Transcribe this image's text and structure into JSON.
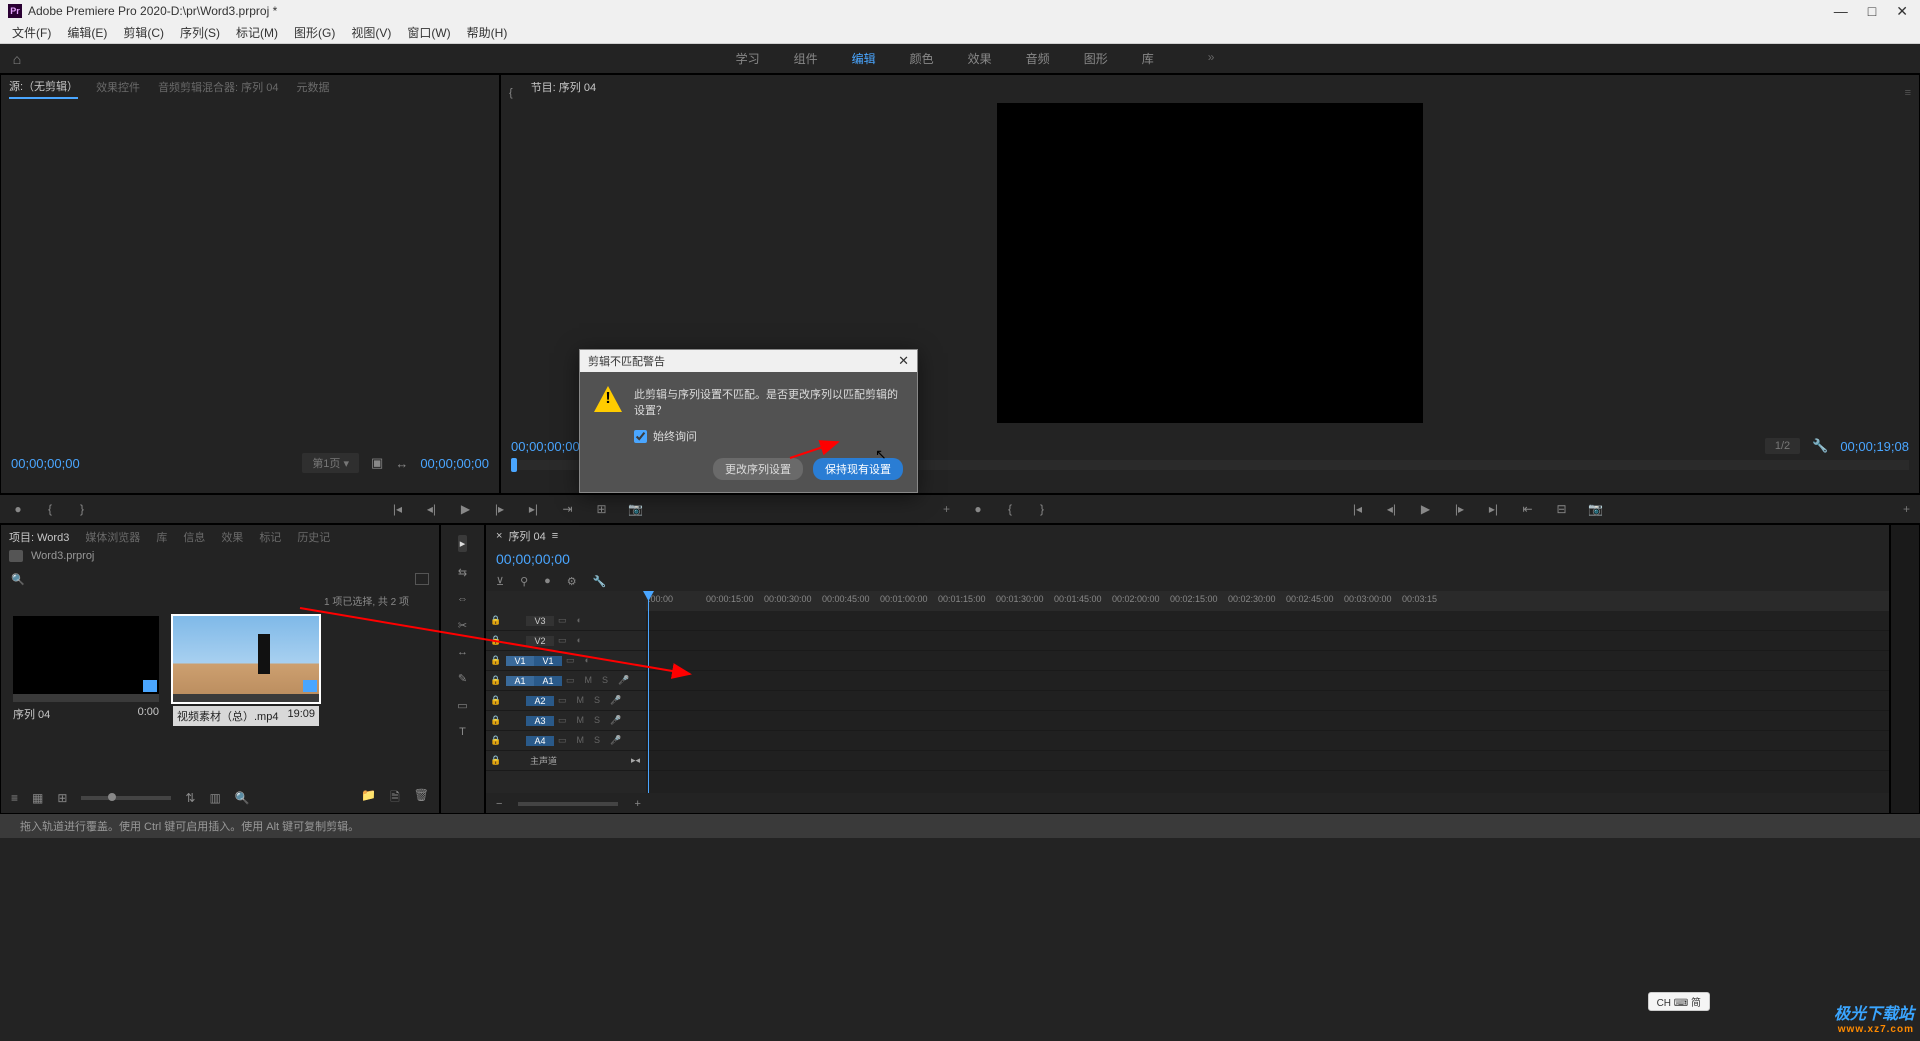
{
  "titlebar": {
    "app": "Adobe Premiere Pro 2020",
    "sep": " - ",
    "path": "D:\\pr\\Word3.prproj *"
  },
  "menu": [
    "文件(F)",
    "编辑(E)",
    "剪辑(C)",
    "序列(S)",
    "标记(M)",
    "图形(G)",
    "视图(V)",
    "窗口(W)",
    "帮助(H)"
  ],
  "workspace": {
    "items": [
      "学习",
      "组件",
      "编辑",
      "颜色",
      "效果",
      "音频",
      "图形",
      "库"
    ],
    "active": "编辑"
  },
  "source": {
    "tabs": [
      "源:（无剪辑）",
      "效果控件",
      "音频剪辑混合器: 序列 04",
      "元数据"
    ],
    "active": "源:（无剪辑）",
    "tc_left": "00;00;00;00",
    "page_picker": "第1页 ▾",
    "tc_right": "00;00;00;00"
  },
  "program": {
    "tab": "节目: 序列 04",
    "tc_left": "00;00;00;00",
    "zoom": "1/2",
    "tc_right": "00;00;19;08"
  },
  "project": {
    "tabs": [
      "项目: Word3",
      "媒体浏览器",
      "库",
      "信息",
      "效果",
      "标记",
      "历史记"
    ],
    "active": "项目: Word3",
    "breadcrumb": "Word3.prproj",
    "status": "1 项已选择, 共 2 项",
    "bins": [
      {
        "name": "序列 04",
        "dur": "0:00",
        "sky": false
      },
      {
        "name": "视频素材（总）.mp4",
        "dur": "19:09",
        "sky": true
      }
    ]
  },
  "tools": [
    "▸",
    "⇆",
    "✂",
    "↔",
    "✎",
    "▭",
    "T"
  ],
  "timeline": {
    "tab": "序列 04",
    "tc": "00;00;00;00",
    "ruler": [
      ":00:00",
      "00:00:15:00",
      "00:00:30:00",
      "00:00:45:00",
      "00:01:00:00",
      "00:01:15:00",
      "00:01:30:00",
      "00:01:45:00",
      "00:02:00:00",
      "00:02:15:00",
      "00:02:30:00",
      "00:02:45:00",
      "00:03:00:00",
      "00:03:15"
    ],
    "vtracks": [
      {
        "src": "",
        "name": "V3"
      },
      {
        "src": "",
        "name": "V2"
      },
      {
        "src": "V1",
        "name": "V1"
      }
    ],
    "atracks": [
      {
        "src": "A1",
        "name": "A1"
      },
      {
        "src": "",
        "name": "A2"
      },
      {
        "src": "",
        "name": "A3"
      },
      {
        "src": "",
        "name": "A4"
      }
    ],
    "master": "主声道"
  },
  "status": "拖入轨道进行覆盖。使用 Ctrl 键可启用插入。使用 Alt 键可复制剪辑。",
  "dialog": {
    "title": "剪辑不匹配警告",
    "message": "此剪辑与序列设置不匹配。是否更改序列以匹配剪辑的设置？",
    "checkbox": "始终询问",
    "btn1": "更改序列设置",
    "btn2": "保持现有设置"
  },
  "ime": "CH ⌨ 简",
  "watermark": {
    "line1": "极光下载站",
    "line2": "www.xz7.com"
  }
}
